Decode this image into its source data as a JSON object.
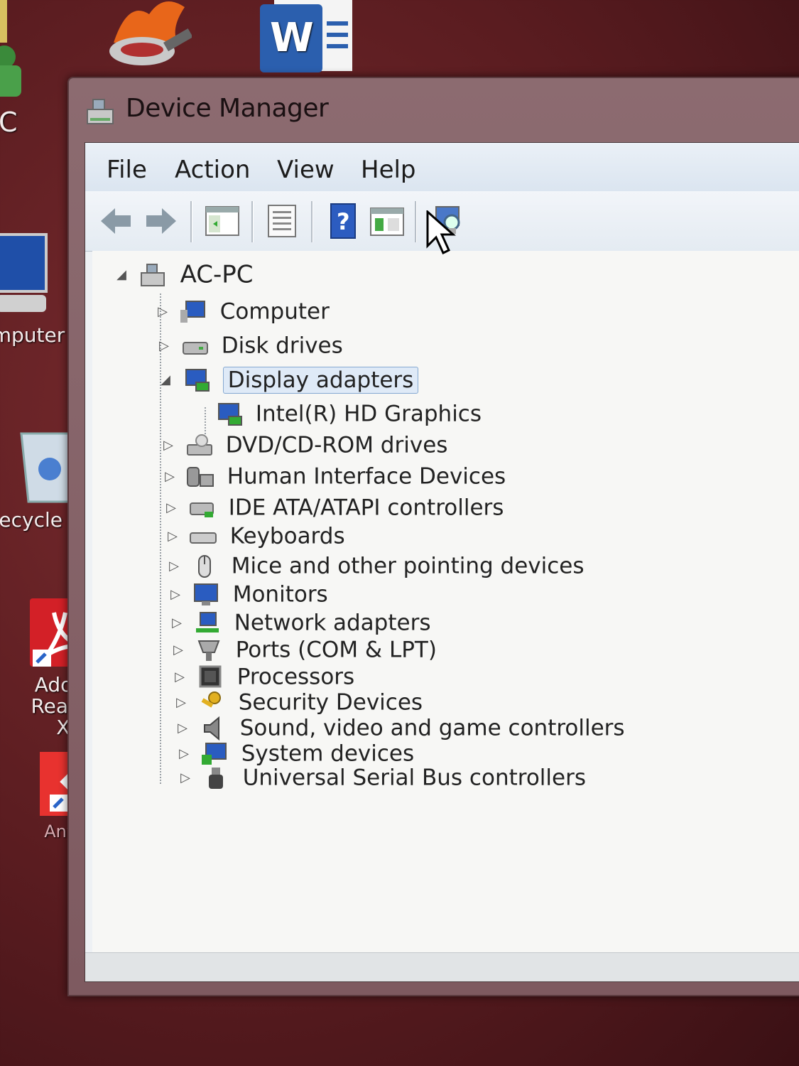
{
  "desktop": {
    "icons": [
      {
        "label": "C"
      },
      {
        "label": "mputer"
      },
      {
        "label": "ecycle Bin"
      },
      {
        "label": "Adobe Reader XI"
      },
      {
        "label": "AnyDesk"
      }
    ]
  },
  "window": {
    "title": "Device Manager",
    "menu": [
      "File",
      "Action",
      "View",
      "Help"
    ],
    "toolbar_icons": [
      "back-icon",
      "forward-icon",
      "show-hide-console-tree-icon",
      "properties-icon",
      "help-icon",
      "update-driver-icon",
      "scan-hardware-icon"
    ]
  },
  "tree": {
    "root": "AC-PC",
    "items": [
      {
        "label": "Computer",
        "icon": "computer-icon",
        "expanded": false
      },
      {
        "label": "Disk drives",
        "icon": "disk-icon",
        "expanded": false
      },
      {
        "label": "Display adapters",
        "icon": "display-icon",
        "expanded": true,
        "selected": true
      },
      {
        "label": "Intel(R) HD Graphics",
        "icon": "display-icon",
        "child": true
      },
      {
        "label": "DVD/CD-ROM drives",
        "icon": "dvd-icon",
        "expanded": false
      },
      {
        "label": "Human Interface Devices",
        "icon": "hid-icon",
        "expanded": false
      },
      {
        "label": "IDE ATA/ATAPI controllers",
        "icon": "ide-icon",
        "expanded": false
      },
      {
        "label": "Keyboards",
        "icon": "keyboard-icon",
        "expanded": false
      },
      {
        "label": "Mice and other pointing devices",
        "icon": "mouse-icon",
        "expanded": false
      },
      {
        "label": "Monitors",
        "icon": "monitor-icon",
        "expanded": false
      },
      {
        "label": "Network adapters",
        "icon": "network-icon",
        "expanded": false
      },
      {
        "label": "Ports (COM & LPT)",
        "icon": "port-icon",
        "expanded": false
      },
      {
        "label": "Processors",
        "icon": "processor-icon",
        "expanded": false
      },
      {
        "label": "Security Devices",
        "icon": "security-icon",
        "expanded": false
      },
      {
        "label": "Sound, video and game controllers",
        "icon": "sound-icon",
        "expanded": false
      },
      {
        "label": "System devices",
        "icon": "system-icon",
        "expanded": false
      },
      {
        "label": "Universal Serial Bus controllers",
        "icon": "usb-icon",
        "expanded": false
      }
    ]
  }
}
